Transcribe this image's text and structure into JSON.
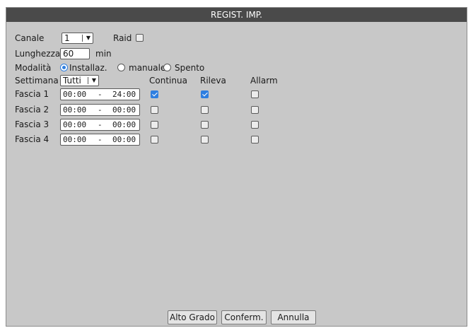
{
  "window": {
    "title": "REGIST. IMP."
  },
  "form": {
    "canale": {
      "label": "Canale",
      "value": "1"
    },
    "raid": {
      "label": "Raid",
      "checked": false
    },
    "lunghezza": {
      "label": "Lunghezza",
      "value": "60",
      "unit": "min"
    },
    "modalita": {
      "label": "Modalità",
      "options": [
        {
          "label": "Installaz.",
          "selected": true
        },
        {
          "label": "manuale",
          "selected": false
        },
        {
          "label": "Spento",
          "selected": false
        }
      ]
    },
    "settimana": {
      "label": "Settimana",
      "value": "Tutti"
    }
  },
  "table": {
    "headers": [
      "Continua",
      "Rileva",
      "Allarm"
    ],
    "rows": [
      {
        "label": "Fascia 1",
        "start": "00:00",
        "sep": "-",
        "end": "24:00",
        "continua": true,
        "rileva": true,
        "allarm": false
      },
      {
        "label": "Fascia 2",
        "start": "00:00",
        "sep": "-",
        "end": "00:00",
        "continua": false,
        "rileva": false,
        "allarm": false
      },
      {
        "label": "Fascia 3",
        "start": "00:00",
        "sep": "-",
        "end": "00:00",
        "continua": false,
        "rileva": false,
        "allarm": false
      },
      {
        "label": "Fascia 4",
        "start": "00:00",
        "sep": "-",
        "end": "00:00",
        "continua": false,
        "rileva": false,
        "allarm": false
      }
    ]
  },
  "buttons": {
    "advanced": "Alto Grado",
    "confirm": "Conferm.",
    "cancel": "Annulla"
  },
  "icons": {
    "dropdown": "chevron-down-icon",
    "check": "checkmark-icon"
  },
  "colors": {
    "titlebar": "#4a4a4a",
    "panel": "#c8c8c8",
    "accent": "#2f7fe0"
  }
}
